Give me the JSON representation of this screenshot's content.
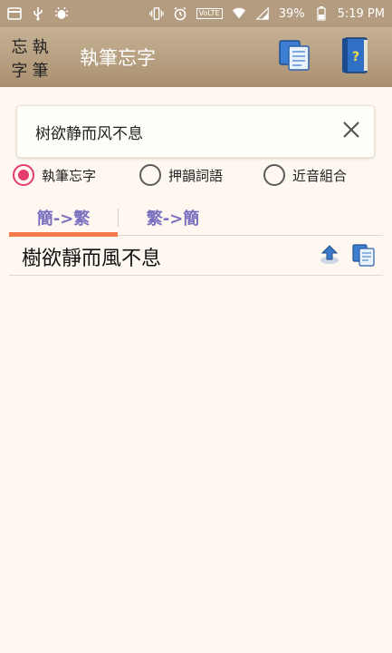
{
  "status_bar": {
    "battery_percent": "39%",
    "time": "5:19 PM",
    "network_badge": "VoLTE",
    "cell_badge": "4G"
  },
  "app_bar": {
    "logo_chars": [
      "忘",
      "執",
      "字",
      "筆"
    ],
    "title": "執筆忘字",
    "icons": [
      "copy-pages-icon",
      "help-book-icon"
    ]
  },
  "search": {
    "value": "树欲静而风不息"
  },
  "modes": [
    {
      "label": "執筆忘字",
      "checked": true
    },
    {
      "label": "押韻詞語",
      "checked": false
    },
    {
      "label": "近音組合",
      "checked": false
    }
  ],
  "tabs": [
    {
      "label": "簡->繁",
      "active": true
    },
    {
      "label": "繁->簡",
      "active": false
    }
  ],
  "result": {
    "text": "樹欲靜而風不息"
  },
  "colors": {
    "accent": "#e53d6f",
    "tab_text": "#7b6fc0",
    "tab_indicator": "#f47a4a",
    "app_bar": "#b39c80"
  }
}
